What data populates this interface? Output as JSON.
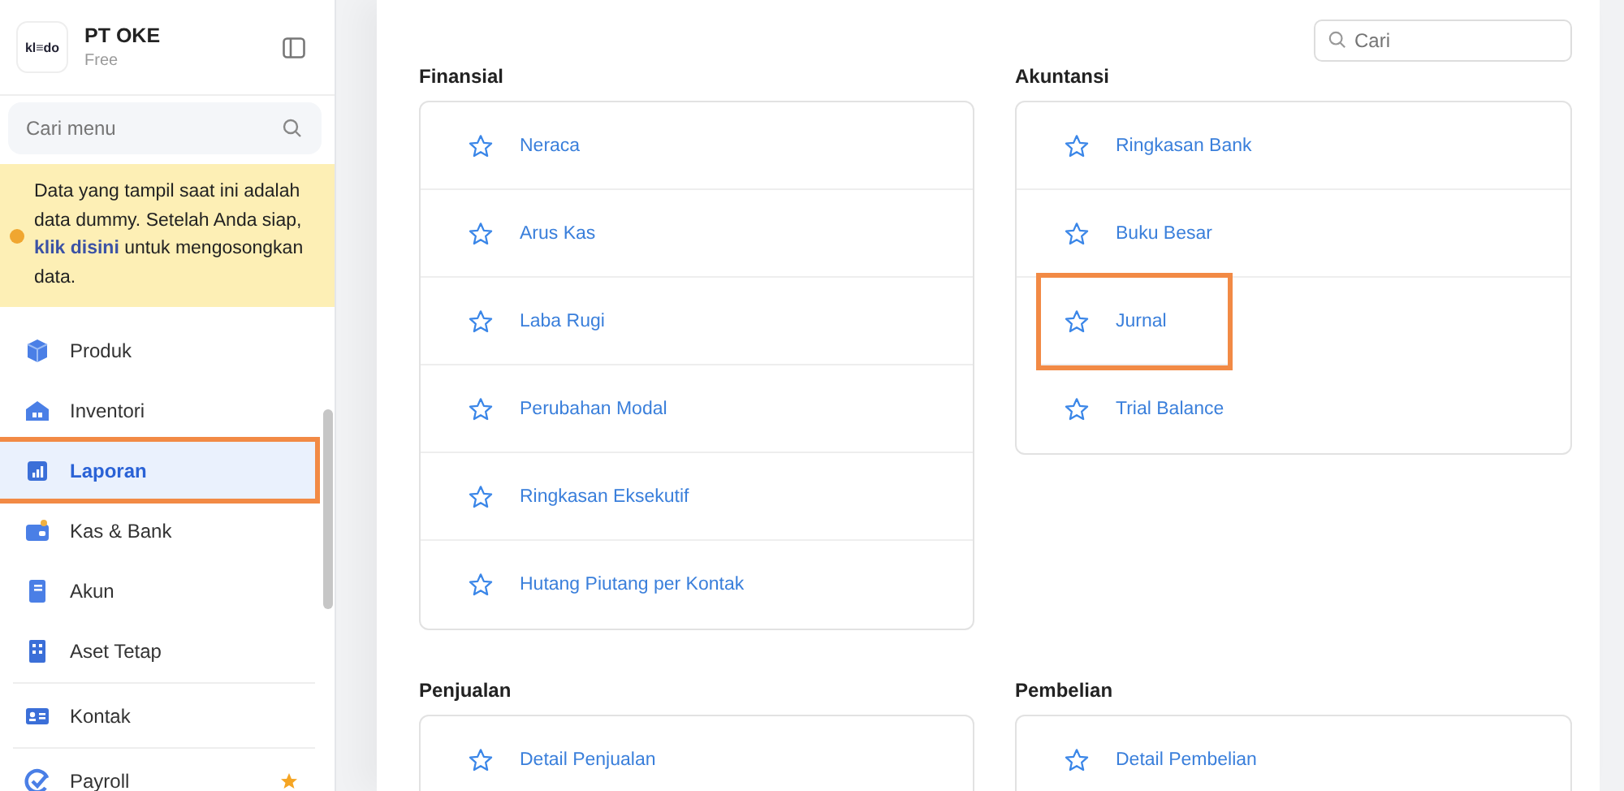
{
  "company": {
    "logo": "kl≡do",
    "name": "PT OKE",
    "plan": "Free"
  },
  "sidebar": {
    "search": {
      "placeholder": "Cari menu"
    },
    "notice": {
      "text": "Data yang tampil saat ini adalah data dummy. Setelah Anda siap,",
      "link": "klik disini",
      "after": "untuk mengosongkan data."
    },
    "items": [
      {
        "label": "Produk",
        "kind": "box",
        "selected": false,
        "highlighted": false,
        "starred": false,
        "divider_before": false
      },
      {
        "label": "Inventori",
        "kind": "warehouse",
        "selected": false,
        "highlighted": false,
        "starred": false,
        "divider_before": false
      },
      {
        "label": "Laporan",
        "kind": "chart",
        "selected": true,
        "highlighted": true,
        "starred": false,
        "divider_before": false
      },
      {
        "label": "Kas & Bank",
        "kind": "wallet",
        "selected": false,
        "highlighted": false,
        "starred": false,
        "divider_before": false
      },
      {
        "label": "Akun",
        "kind": "book",
        "selected": false,
        "highlighted": false,
        "starred": false,
        "divider_before": false
      },
      {
        "label": "Aset Tetap",
        "kind": "building",
        "selected": false,
        "highlighted": false,
        "starred": false,
        "divider_before": false
      },
      {
        "label": "Kontak",
        "kind": "card",
        "selected": false,
        "highlighted": false,
        "starred": false,
        "divider_before": true
      },
      {
        "label": "Payroll",
        "kind": "check",
        "selected": false,
        "highlighted": false,
        "starred": true,
        "divider_before": true
      }
    ]
  },
  "search": {
    "placeholder": "Cari"
  },
  "sections": [
    {
      "title": "Finansial",
      "reports": [
        {
          "label": "Neraca",
          "starred": false,
          "highlighted": false
        },
        {
          "label": "Arus Kas",
          "starred": false,
          "highlighted": false
        },
        {
          "label": "Laba Rugi",
          "starred": false,
          "highlighted": false
        },
        {
          "label": "Perubahan Modal",
          "starred": false,
          "highlighted": false
        },
        {
          "label": "Ringkasan Eksekutif",
          "starred": false,
          "highlighted": false
        },
        {
          "label": "Hutang Piutang per Kontak",
          "starred": false,
          "highlighted": false
        }
      ]
    },
    {
      "title": "Akuntansi",
      "reports": [
        {
          "label": "Ringkasan Bank",
          "starred": false,
          "highlighted": false
        },
        {
          "label": "Buku Besar",
          "starred": false,
          "highlighted": false
        },
        {
          "label": "Jurnal",
          "starred": false,
          "highlighted": true
        },
        {
          "label": "Trial Balance",
          "starred": false,
          "highlighted": false
        }
      ]
    },
    {
      "title": "Penjualan",
      "reports": [
        {
          "label": "Detail Penjualan",
          "starred": false,
          "highlighted": false
        }
      ]
    },
    {
      "title": "Pembelian",
      "reports": [
        {
          "label": "Detail Pembelian",
          "starred": false,
          "highlighted": false
        }
      ]
    }
  ]
}
